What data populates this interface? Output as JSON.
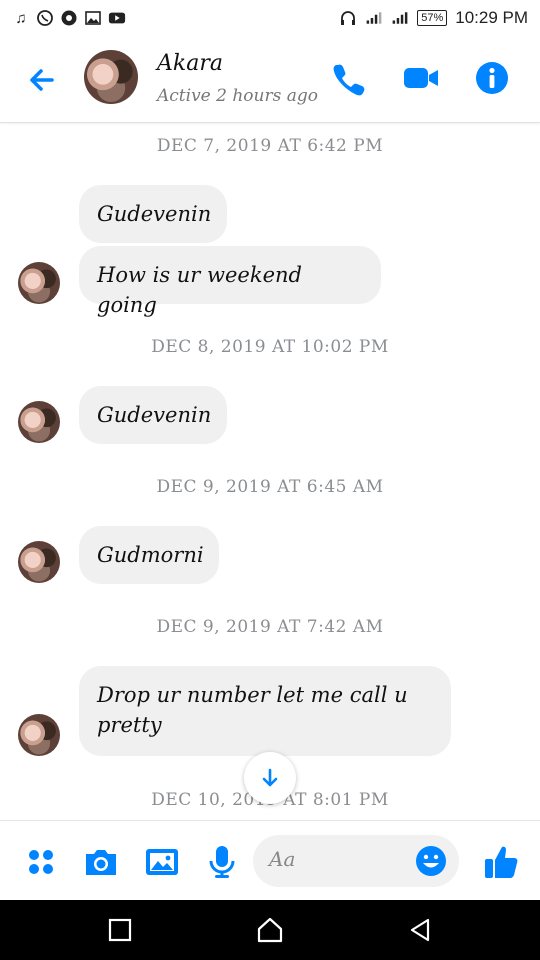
{
  "status_bar": {
    "time": "10:29 PM",
    "battery": "57%",
    "left_icons": [
      "music-note-icon",
      "whatsapp-icon",
      "share-icon",
      "image-icon",
      "youtube-icon"
    ],
    "right_icons": [
      "headphones-icon",
      "signal-icon",
      "signal-icon-2",
      "battery-icon"
    ]
  },
  "header": {
    "contact_name": "Akara",
    "contact_status": "Active 2 hours ago",
    "accent_color": "#0084ff"
  },
  "thread": [
    {
      "type": "timestamp",
      "text": "DEC 7, 2019 AT 6:42 PM"
    },
    {
      "type": "message",
      "text": "Gudevenin"
    },
    {
      "type": "message",
      "text": "How is ur weekend going"
    },
    {
      "type": "timestamp",
      "text": "DEC 8, 2019 AT 10:02 PM"
    },
    {
      "type": "message",
      "text": "Gudevenin"
    },
    {
      "type": "timestamp",
      "text": "DEC 9, 2019 AT 6:45 AM"
    },
    {
      "type": "message",
      "text": "Gudmorni"
    },
    {
      "type": "timestamp",
      "text": "DEC 9, 2019 AT 7:42 AM"
    },
    {
      "type": "message",
      "text": "Drop ur number let me call u pretty"
    },
    {
      "type": "timestamp",
      "text": "DEC 10, 2019 AT 8:01 PM"
    }
  ],
  "composer": {
    "placeholder": "Aa"
  }
}
